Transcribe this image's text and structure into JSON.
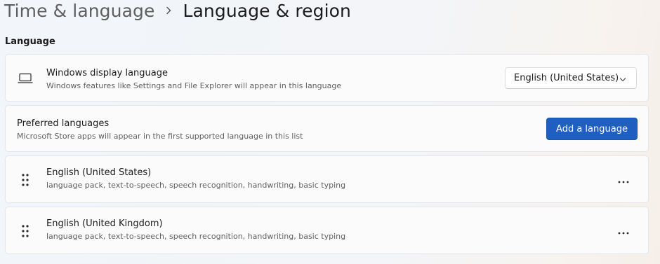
{
  "breadcrumb": {
    "parent": "Time & language",
    "separator_icon": "chevron-right-icon",
    "current": "Language & region"
  },
  "language_section": {
    "title": "Language",
    "display_language": {
      "icon": "laptop-icon",
      "title": "Windows display language",
      "description": "Windows features like Settings and File Explorer will appear in this language",
      "selected_value": "English (United States)",
      "dropdown_icon": "chevron-down-icon"
    },
    "preferred_languages": {
      "title": "Preferred languages",
      "description": "Microsoft Store apps will appear in the first supported language in this list",
      "add_button_label": "Add a language"
    },
    "languages": [
      {
        "name": "English (United States)",
        "features": "language pack, text-to-speech, speech recognition, handwriting, basic typing",
        "drag_icon": "drag-handle-icon",
        "menu_icon": "more-options-icon"
      },
      {
        "name": "English (United Kingdom)",
        "features": "language pack, text-to-speech, speech recognition, handwriting, basic typing",
        "drag_icon": "drag-handle-icon",
        "menu_icon": "more-options-icon"
      }
    ]
  },
  "colors": {
    "accent": "#1f5fbf",
    "card_background": "#fbfbfc",
    "secondary_text": "#5f5f5f"
  }
}
